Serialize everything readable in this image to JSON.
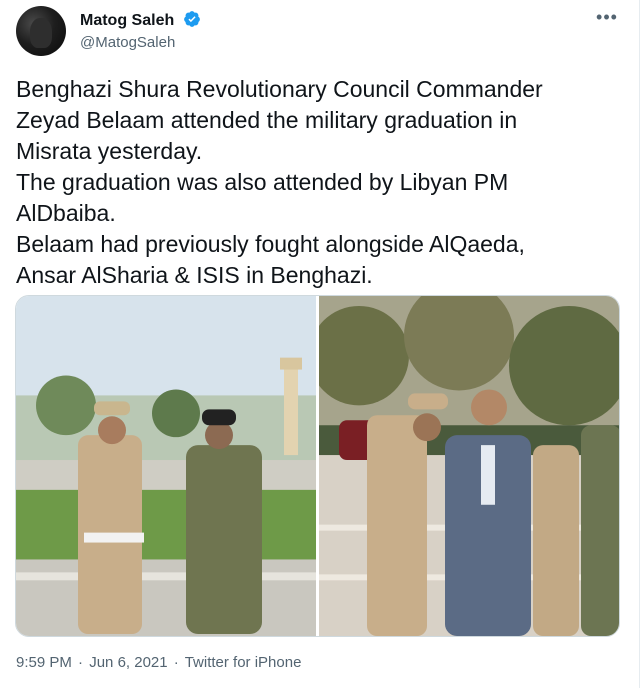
{
  "author": {
    "display_name": "Matog Saleh",
    "handle": "@MatogSaleh",
    "verified": true
  },
  "tweet": {
    "text": "Benghazi Shura Revolutionary Council Commander\nZeyad Belaam attended the military graduation in\nMisrata yesterday.\nThe graduation was also attended by Libyan PM\nAlDbaiba.\nBelaam had previously fought alongside AlQaeda,\nAnsar AlSharia & ISIS in Benghazi.",
    "media": [
      {
        "icon": "photo"
      },
      {
        "icon": "photo"
      }
    ]
  },
  "meta": {
    "time": "9:59 PM",
    "date": "Jun 6, 2021",
    "source": "Twitter for iPhone",
    "separator": "·"
  },
  "icons": {
    "more": "more-horizontal-icon",
    "verified": "verified-badge-icon"
  },
  "colors": {
    "text": "#0f1419",
    "secondary": "#536471",
    "verified": "#1d9bf0",
    "border": "#cfd9de"
  }
}
